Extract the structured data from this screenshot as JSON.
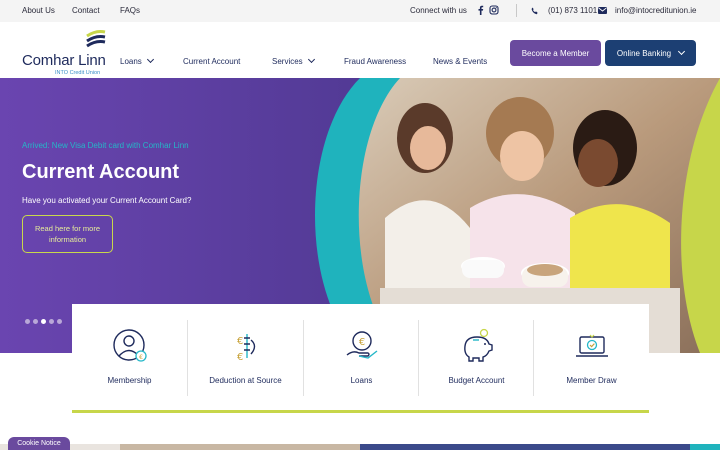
{
  "topbar": {
    "links": [
      "About Us",
      "Contact",
      "FAQs"
    ],
    "connect_label": "Connect with us",
    "phone": "(01) 873 1101",
    "email": "info@intocreditunion.ie",
    "icons": [
      "facebook-icon",
      "instagram-icon",
      "phone-icon",
      "envelope-icon"
    ]
  },
  "header": {
    "logo_name": "Comhar Linn",
    "logo_sub": "INTO Credit Union",
    "nav": [
      {
        "label": "Loans",
        "has_dropdown": true
      },
      {
        "label": "Current Account",
        "has_dropdown": false
      },
      {
        "label": "Services",
        "has_dropdown": true
      },
      {
        "label": "Fraud Awareness",
        "has_dropdown": false
      },
      {
        "label": "News & Events",
        "has_dropdown": false
      }
    ],
    "become_member": "Become a Member",
    "online_banking": "Online Banking"
  },
  "hero": {
    "kicker": "Arrived: New Visa Debit card with Comhar Linn",
    "title": "Current Account",
    "description": "Have you activated your Current Account Card?",
    "cta": "Read here for more information",
    "slides": 5,
    "active_slide": 3
  },
  "quicklinks": [
    {
      "label": "Membership",
      "icon": "member-icon"
    },
    {
      "label": "Deduction at Source",
      "icon": "euro-transfer-icon"
    },
    {
      "label": "Loans",
      "icon": "hand-coin-icon"
    },
    {
      "label": "Budget Account",
      "icon": "piggy-bank-icon"
    },
    {
      "label": "Member Draw",
      "icon": "laptop-draw-icon"
    }
  ],
  "cookie_notice": "Cookie Notice",
  "colors": {
    "navy": "#1e2a5c",
    "purple": "#6a4a9e",
    "teal": "#25b7c8",
    "lime": "#c7d64a",
    "dark_blue": "#1c3f73"
  }
}
